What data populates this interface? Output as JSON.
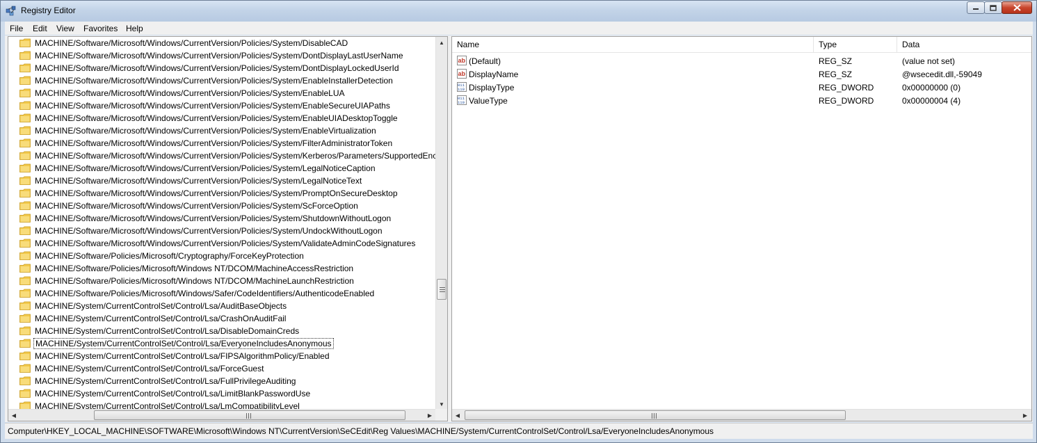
{
  "window": {
    "title": "Registry Editor"
  },
  "menu": [
    "File",
    "Edit",
    "View",
    "Favorites",
    "Help"
  ],
  "tree": {
    "items": [
      "MACHINE/Software/Microsoft/Windows/CurrentVersion/Policies/System/DisableCAD",
      "MACHINE/Software/Microsoft/Windows/CurrentVersion/Policies/System/DontDisplayLastUserName",
      "MACHINE/Software/Microsoft/Windows/CurrentVersion/Policies/System/DontDisplayLockedUserId",
      "MACHINE/Software/Microsoft/Windows/CurrentVersion/Policies/System/EnableInstallerDetection",
      "MACHINE/Software/Microsoft/Windows/CurrentVersion/Policies/System/EnableLUA",
      "MACHINE/Software/Microsoft/Windows/CurrentVersion/Policies/System/EnableSecureUIAPaths",
      "MACHINE/Software/Microsoft/Windows/CurrentVersion/Policies/System/EnableUIADesktopToggle",
      "MACHINE/Software/Microsoft/Windows/CurrentVersion/Policies/System/EnableVirtualization",
      "MACHINE/Software/Microsoft/Windows/CurrentVersion/Policies/System/FilterAdministratorToken",
      "MACHINE/Software/Microsoft/Windows/CurrentVersion/Policies/System/Kerberos/Parameters/SupportedEnc",
      "MACHINE/Software/Microsoft/Windows/CurrentVersion/Policies/System/LegalNoticeCaption",
      "MACHINE/Software/Microsoft/Windows/CurrentVersion/Policies/System/LegalNoticeText",
      "MACHINE/Software/Microsoft/Windows/CurrentVersion/Policies/System/PromptOnSecureDesktop",
      "MACHINE/Software/Microsoft/Windows/CurrentVersion/Policies/System/ScForceOption",
      "MACHINE/Software/Microsoft/Windows/CurrentVersion/Policies/System/ShutdownWithoutLogon",
      "MACHINE/Software/Microsoft/Windows/CurrentVersion/Policies/System/UndockWithoutLogon",
      "MACHINE/Software/Microsoft/Windows/CurrentVersion/Policies/System/ValidateAdminCodeSignatures",
      "MACHINE/Software/Policies/Microsoft/Cryptography/ForceKeyProtection",
      "MACHINE/Software/Policies/Microsoft/Windows NT/DCOM/MachineAccessRestriction",
      "MACHINE/Software/Policies/Microsoft/Windows NT/DCOM/MachineLaunchRestriction",
      "MACHINE/Software/Policies/Microsoft/Windows/Safer/CodeIdentifiers/AuthenticodeEnabled",
      "MACHINE/System/CurrentControlSet/Control/Lsa/AuditBaseObjects",
      "MACHINE/System/CurrentControlSet/Control/Lsa/CrashOnAuditFail",
      "MACHINE/System/CurrentControlSet/Control/Lsa/DisableDomainCreds",
      "MACHINE/System/CurrentControlSet/Control/Lsa/EveryoneIncludesAnonymous",
      "MACHINE/System/CurrentControlSet/Control/Lsa/FIPSAlgorithmPolicy/Enabled",
      "MACHINE/System/CurrentControlSet/Control/Lsa/ForceGuest",
      "MACHINE/System/CurrentControlSet/Control/Lsa/FullPrivilegeAuditing",
      "MACHINE/System/CurrentControlSet/Control/Lsa/LimitBlankPasswordUse",
      "MACHINE/System/CurrentControlSet/Control/Lsa/LmCompatibilityLevel"
    ],
    "selected": "MACHINE/System/CurrentControlSet/Control/Lsa/EveryoneIncludesAnonymous"
  },
  "list": {
    "columns": [
      "Name",
      "Type",
      "Data"
    ],
    "rows": [
      {
        "icon": "string-value-icon",
        "name": "(Default)",
        "type": "REG_SZ",
        "data": "(value not set)"
      },
      {
        "icon": "string-value-icon",
        "name": "DisplayName",
        "type": "REG_SZ",
        "data": "@wsecedit.dll,-59049"
      },
      {
        "icon": "dword-value-icon",
        "name": "DisplayType",
        "type": "REG_DWORD",
        "data": "0x00000000 (0)"
      },
      {
        "icon": "dword-value-icon",
        "name": "ValueType",
        "type": "REG_DWORD",
        "data": "0x00000004 (4)"
      }
    ]
  },
  "status": {
    "path": "Computer\\HKEY_LOCAL_MACHINE\\SOFTWARE\\Microsoft\\Windows NT\\CurrentVersion\\SeCEdit\\Reg Values\\MACHINE/System/CurrentControlSet/Control/Lsa/EveryoneIncludesAnonymous"
  },
  "colors": {
    "title_bar": "#c3d4e8",
    "close_button": "#c8452d",
    "folder": "#f2c94c",
    "selection_border": "#333333"
  },
  "icons": {
    "app": "registry-editor-icon",
    "folder": "folder-icon",
    "string": "string-value-icon",
    "dword": "dword-value-icon"
  }
}
